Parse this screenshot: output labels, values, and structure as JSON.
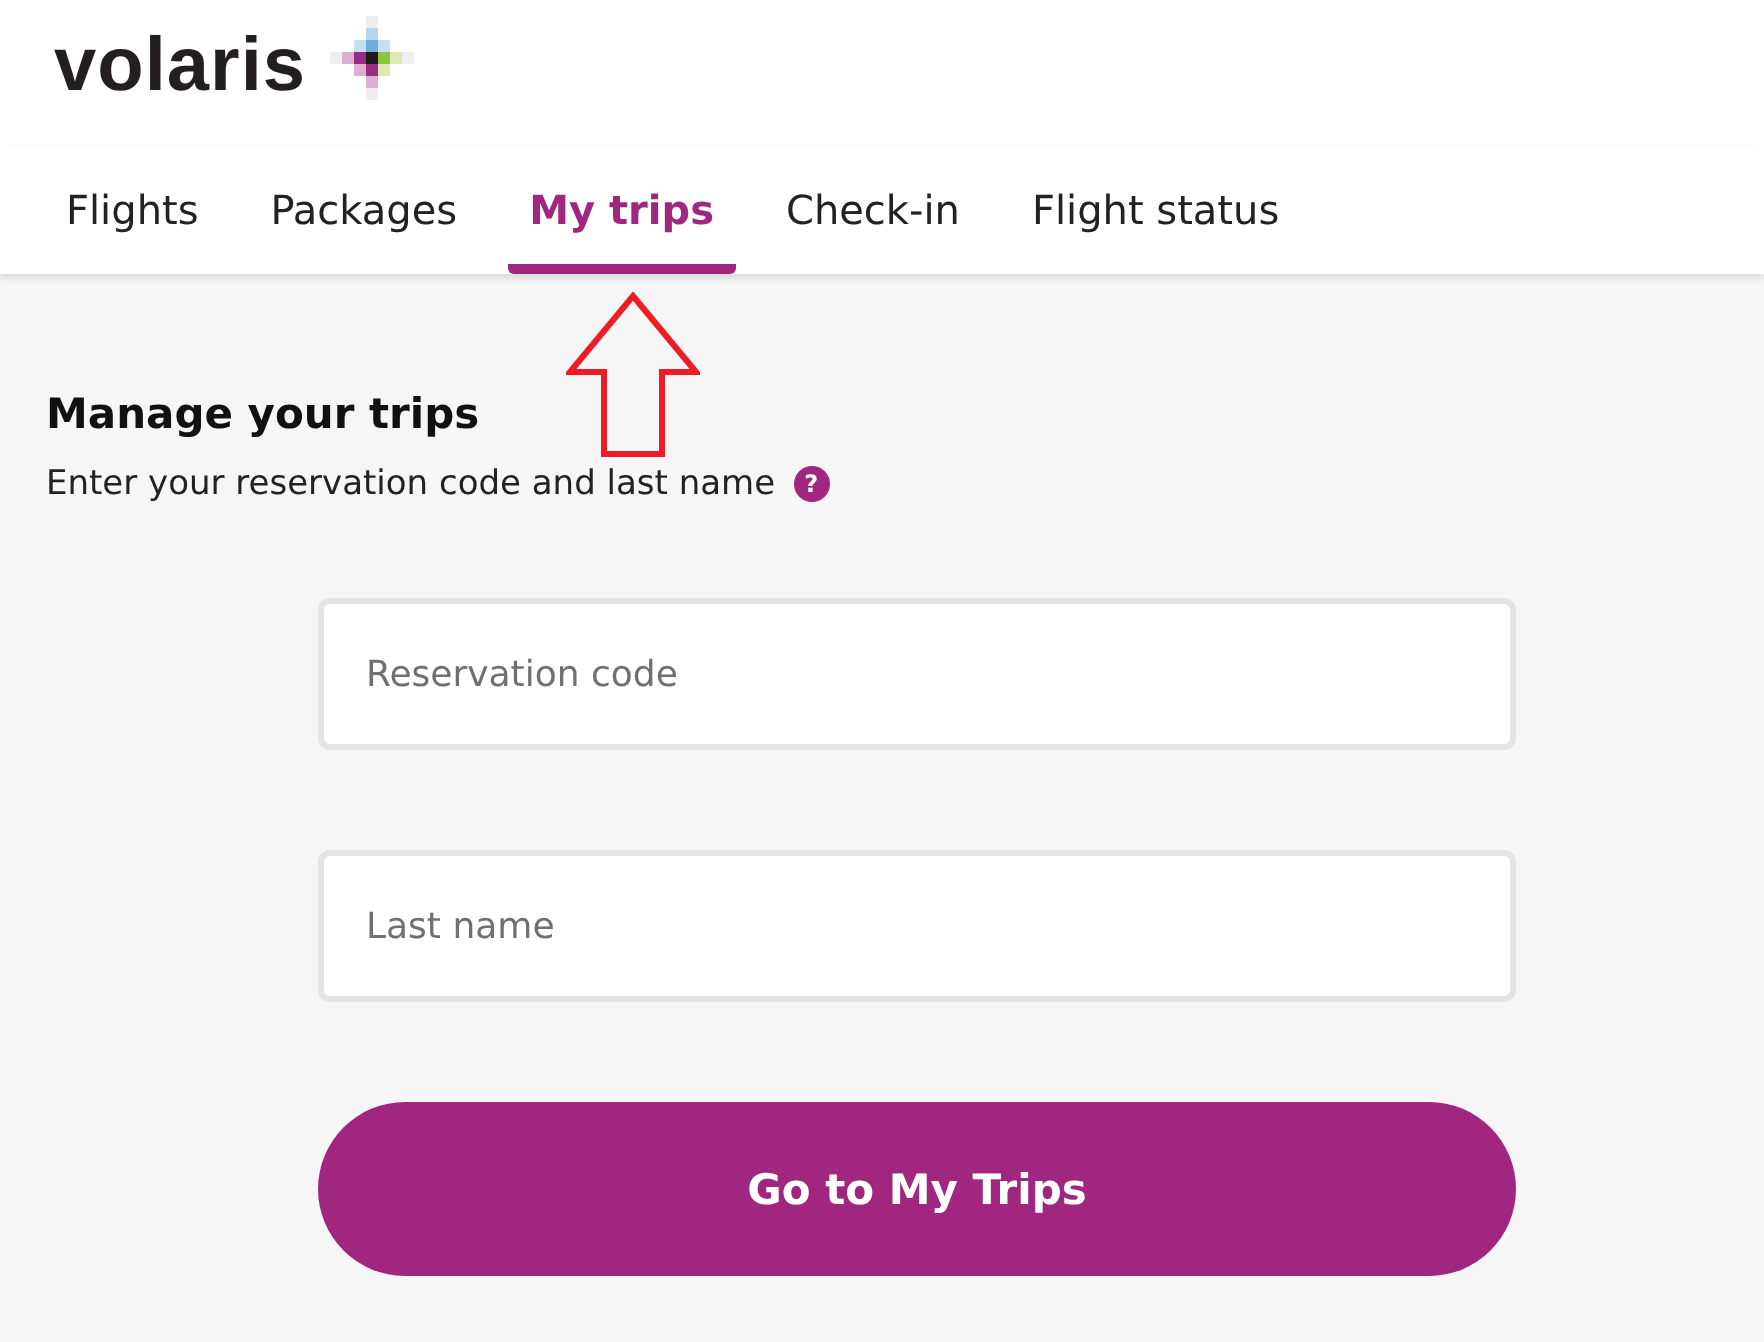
{
  "header": {
    "logo_text": "volaris"
  },
  "tabs": [
    {
      "label": "Flights",
      "selected": false
    },
    {
      "label": "Packages",
      "selected": false
    },
    {
      "label": "My trips",
      "selected": true
    },
    {
      "label": "Check-in",
      "selected": false
    },
    {
      "label": "Flight status",
      "selected": false
    }
  ],
  "form": {
    "title": "Manage your trips",
    "subtitle": "Enter your reservation code and last name",
    "help_icon": "?",
    "fields": [
      {
        "placeholder": "Reservation code"
      },
      {
        "placeholder": "Last name"
      }
    ],
    "button": "Go to My Trips"
  }
}
